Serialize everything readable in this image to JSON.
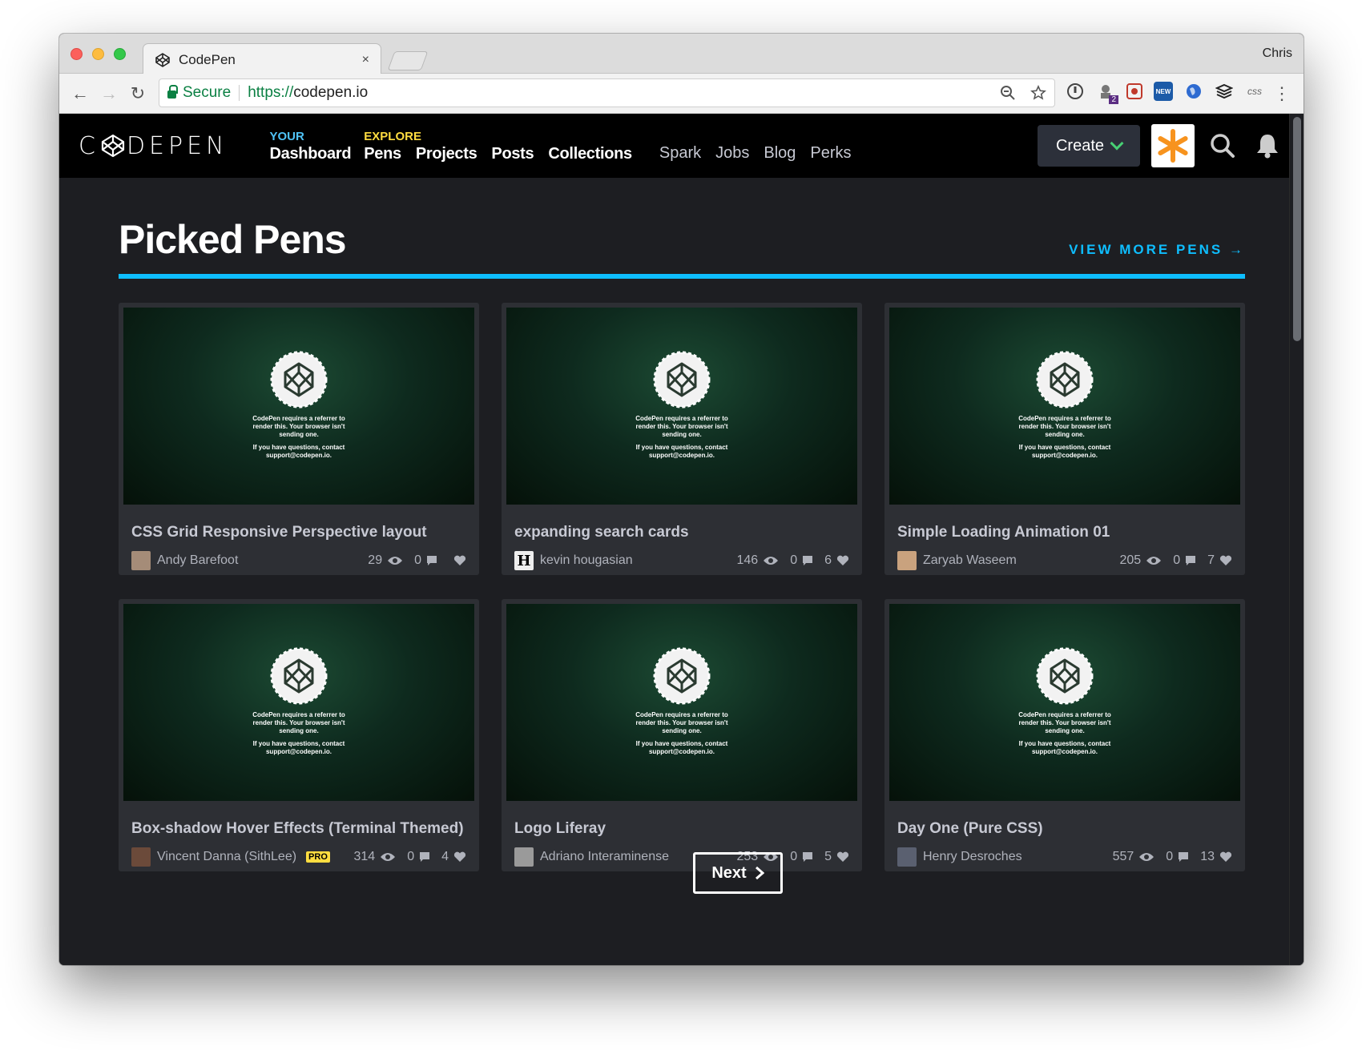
{
  "browser": {
    "tab_title": "CodePen",
    "tab_close": "×",
    "profile": "Chris",
    "secure_label": "Secure",
    "url_protocol": "https://",
    "url_host": "codepen.io"
  },
  "header": {
    "logo_text_left": "C",
    "logo_text_right": "DEPEN",
    "your_label": "YOUR",
    "explore_label": "EXPLORE",
    "nav_dashboard": "Dashboard",
    "nav_pens": "Pens",
    "nav_projects": "Projects",
    "nav_posts": "Posts",
    "nav_collections": "Collections",
    "nav_spark": "Spark",
    "nav_jobs": "Jobs",
    "nav_blog": "Blog",
    "nav_perks": "Perks",
    "create_label": "Create"
  },
  "section": {
    "title": "Picked Pens",
    "view_more": "VIEW MORE PENS →"
  },
  "preview_text": {
    "line1": "CodePen requires a referrer to render this. Your browser isn't sending one.",
    "line2": "If you have questions, contact support@codepen.io."
  },
  "pens": [
    {
      "title": "CSS Grid Responsive Perspective layout",
      "author": "Andy Barefoot",
      "views": "29",
      "comments": "0",
      "loves": ""
    },
    {
      "title": "expanding search cards",
      "author": "kevin hougasian",
      "views": "146",
      "comments": "0",
      "loves": "6"
    },
    {
      "title": "Simple Loading Animation 01",
      "author": "Zaryab Waseem",
      "views": "205",
      "comments": "0",
      "loves": "7"
    },
    {
      "title": "Box-shadow Hover Effects (Terminal Themed)",
      "author": "Vincent Danna (SithLee)",
      "badge": "PRO",
      "views": "314",
      "comments": "0",
      "loves": "4"
    },
    {
      "title": "Logo Liferay",
      "author": "Adriano Interaminense",
      "views": "253",
      "comments": "0",
      "loves": "5"
    },
    {
      "title": "Day One (Pure CSS)",
      "author": "Henry Desroches",
      "views": "557",
      "comments": "0",
      "loves": "13"
    }
  ],
  "pagination": {
    "next_label": "Next"
  },
  "colors": {
    "accent_blue": "#0ebeff",
    "accent_green": "#47cf73",
    "accent_yellow": "#ffdd40"
  }
}
